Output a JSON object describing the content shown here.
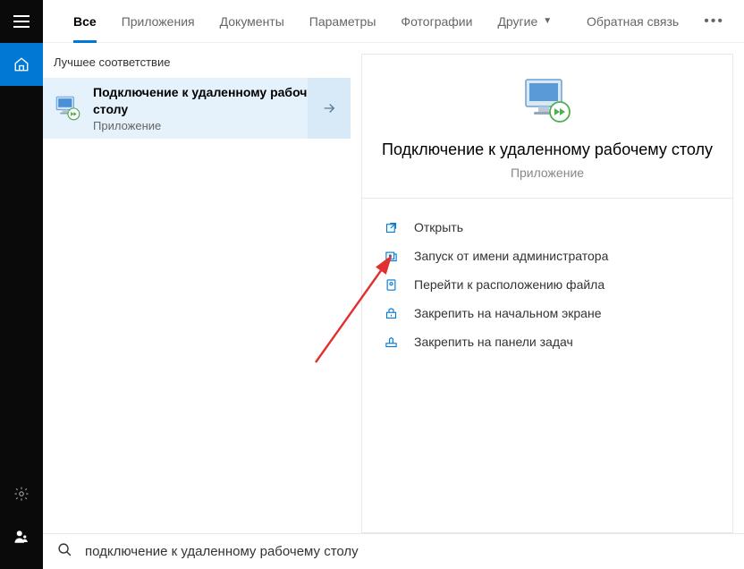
{
  "tabs": {
    "all": "Все",
    "apps": "Приложения",
    "docs": "Документы",
    "settings": "Параметры",
    "photos": "Фотографии",
    "more": "Другие"
  },
  "feedback": "Обратная связь",
  "results": {
    "section": "Лучшее соответствие",
    "item": {
      "title": "Подключение к удаленному рабочему столу",
      "type": "Приложение"
    }
  },
  "details": {
    "title": "Подключение к удаленному рабочему столу",
    "type": "Приложение"
  },
  "actions": {
    "open": "Открыть",
    "run_admin": "Запуск от имени администратора",
    "file_location": "Перейти к расположению файла",
    "pin_start": "Закрепить на начальном экране",
    "pin_taskbar": "Закрепить на панели задач"
  },
  "search": {
    "value": "подключение к удаленному рабочему столу"
  }
}
